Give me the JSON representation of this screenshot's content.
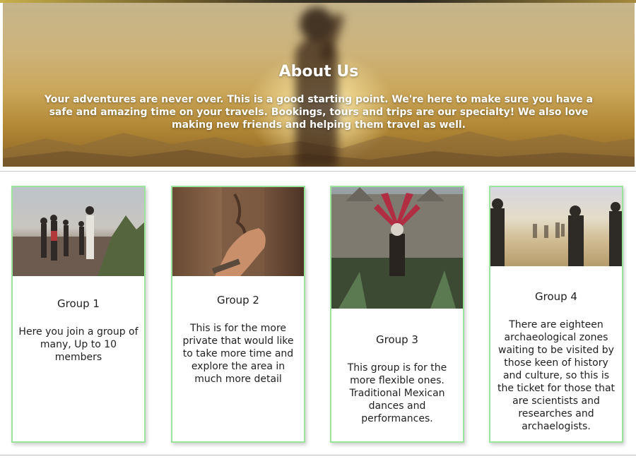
{
  "hero": {
    "title": "About Us",
    "text": "Your adventures are never over. This is a good starting point. We're here to make sure you have a safe and amazing time on your travels. Bookings, tours and trips are our specialty! We also love making new friends and helping them travel as well."
  },
  "groups": [
    {
      "name": "Group 1",
      "description": "Here you join a group of many, Up to 10 members",
      "photo": "hikers-on-rocks-photo"
    },
    {
      "name": "Group 2",
      "description": "This is for the more private that would like to take more time and explore the area in much more detail",
      "photo": "hand-on-carved-stone-photo"
    },
    {
      "name": "Group 3",
      "description": "This group is for the more flexible ones. Traditional Mexican dances and performances.",
      "photo": "traditional-dancer-photo"
    },
    {
      "name": "Group 4",
      "description": "There are eighteen archaeological zones waiting to be visited by those keen of history and culture, so this is the ticket for those that are scientists and researches and archaelogists.",
      "photo": "people-in-misty-field-photo"
    }
  ],
  "colors": {
    "card_border": "#9be59b",
    "hero_text": "#ffffff"
  }
}
